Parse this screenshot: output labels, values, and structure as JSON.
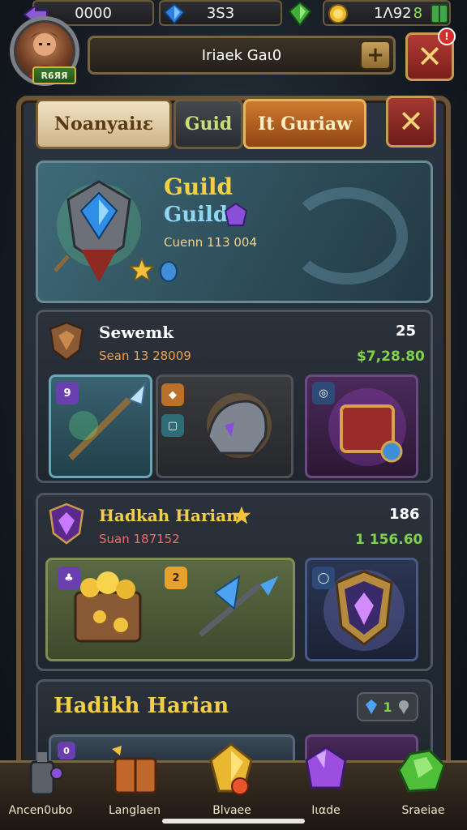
{
  "resources": {
    "coins": "0000",
    "gems": "3Ѕ3",
    "emeralds": "",
    "gold": "1Λ92",
    "gold_suffix": "8"
  },
  "profile": {
    "level_badge": "R6ЯЯ",
    "name": "Ιriaek Gaι0",
    "notification_count": "!"
  },
  "tabs": [
    {
      "label": "Noanyaiıε"
    },
    {
      "label": "Guid"
    },
    {
      "label": "Ιt Guriaw"
    }
  ],
  "hero": {
    "title": "Guild",
    "subtitle": "Guild",
    "count": "Cuenn 113 004"
  },
  "sections": [
    {
      "title": "Sewemk",
      "subtitle": "Sean 13 28009",
      "count": "25",
      "price": "$7,28.80",
      "item_badges": [
        "9",
        "◆",
        "▢",
        "◎"
      ]
    },
    {
      "title": "Hadkah Harian",
      "subtitle": "Suan 187152",
      "count": "186",
      "price": "1  156.60",
      "item_badges": [
        "♣",
        "2",
        "◯"
      ]
    },
    {
      "title": "Hadikh Harian",
      "count_badge": "1",
      "item_badges": [
        "0"
      ]
    }
  ],
  "nav": [
    {
      "label": "Ancen0ubo"
    },
    {
      "label": "Langlaen"
    },
    {
      "label": "Blvaee"
    },
    {
      "label": "Ιιαde"
    },
    {
      "label": "Sraeiae"
    }
  ],
  "colors": {
    "accent_gold": "#f3cf47",
    "accent_blue": "#8fd7f2",
    "price_green": "#7fd34a",
    "frame_brown": "#6c5536"
  }
}
